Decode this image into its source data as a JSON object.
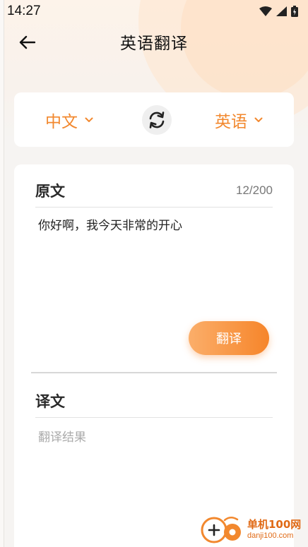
{
  "status_bar": {
    "time": "14:27"
  },
  "header": {
    "title": "英语翻译"
  },
  "languages": {
    "source": "中文",
    "target": "英语"
  },
  "source_section": {
    "title": "原文",
    "char_count": "12/200",
    "text": "你好啊，我今天非常的开心"
  },
  "translate_button": {
    "label": "翻译"
  },
  "result_section": {
    "title": "译文",
    "placeholder": "翻译结果"
  },
  "watermark": {
    "name": "单机100网",
    "url": "danji100.com"
  },
  "colors": {
    "accent": "#f2882e",
    "button_start": "#fbae6a",
    "button_end": "#f6852a"
  },
  "icons": [
    "back-arrow-icon",
    "chevron-down-icon",
    "swap-icon",
    "wifi-icon",
    "signal-icon",
    "battery-icon"
  ]
}
